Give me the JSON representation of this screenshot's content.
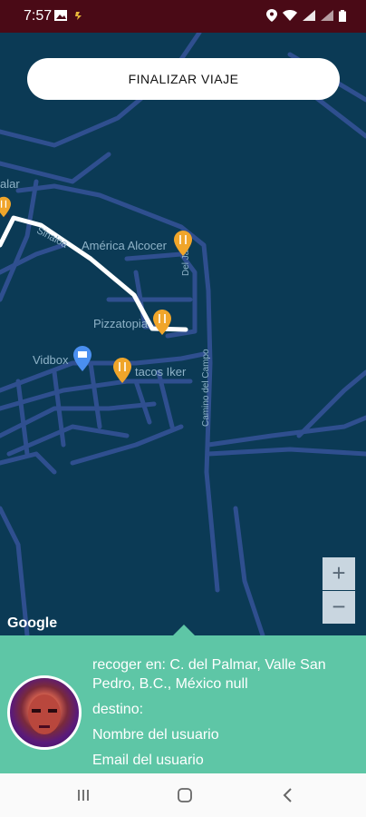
{
  "status": {
    "time": "7:57"
  },
  "map": {
    "labels": {
      "street_left": "alar",
      "diagonal": "Sinaloa",
      "america": "América Alcocer",
      "del_jardin": "Del Jardín",
      "pizzatopia": "Pizzatopia",
      "vidbox": "Vidbox",
      "tacos": "tacos Iker",
      "camino": "Camino del Campo"
    },
    "google": "Google"
  },
  "top_button": {
    "label": "FINALIZAR VIAJE"
  },
  "zoom": {
    "in": "+",
    "out": "−"
  },
  "sheet": {
    "pickup": "recoger en: C. del Palmar, Valle San Pedro, B.C., México null",
    "destination": "destino:",
    "user_name": "Nombre del usuario",
    "user_email": "Email del usuario"
  },
  "colors": {
    "map_bg": "#0b3a55",
    "road": "#2f4f8f",
    "route": "#ffffff",
    "pin": "#f0a52a",
    "sheet": "#5ec6a6",
    "status_bar": "#4a0a16"
  }
}
